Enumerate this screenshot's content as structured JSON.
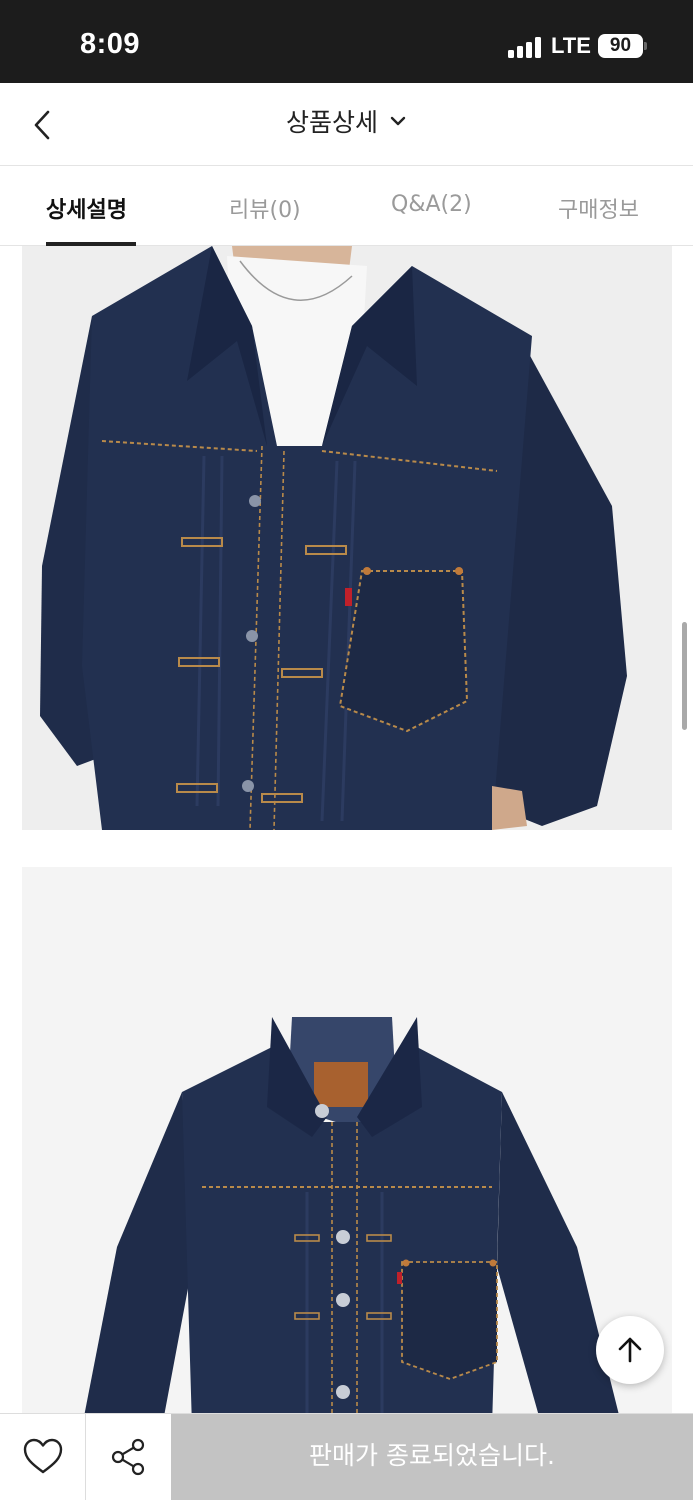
{
  "status_bar": {
    "time": "8:09",
    "network": "LTE",
    "battery": "90"
  },
  "header": {
    "title": "상품상세",
    "back_icon": "chevron-left-icon",
    "dropdown_icon": "chevron-down-icon"
  },
  "tabs": [
    {
      "label": "상세설명",
      "active": true
    },
    {
      "label": "리뷰(0)",
      "active": false
    },
    {
      "label": "Q&A(2)",
      "active": false
    },
    {
      "label": "구매정보",
      "active": false
    }
  ],
  "content": {
    "images": [
      {
        "subject": "model wearing dark indigo denim trucker jacket, close crop"
      },
      {
        "subject": "dark indigo denim trucker jacket, product flat shot"
      }
    ]
  },
  "floating": {
    "scroll_top_icon": "arrow-up-icon"
  },
  "bottom_bar": {
    "like_icon": "heart-icon",
    "share_icon": "share-icon",
    "status_label": "판매가 종료되었습니다."
  },
  "colors": {
    "denim": "#1f2c4a",
    "stitch": "#b98a4a",
    "disabled_button": "#c3c3c3",
    "status_bar_bg": "#1c1c1c"
  }
}
